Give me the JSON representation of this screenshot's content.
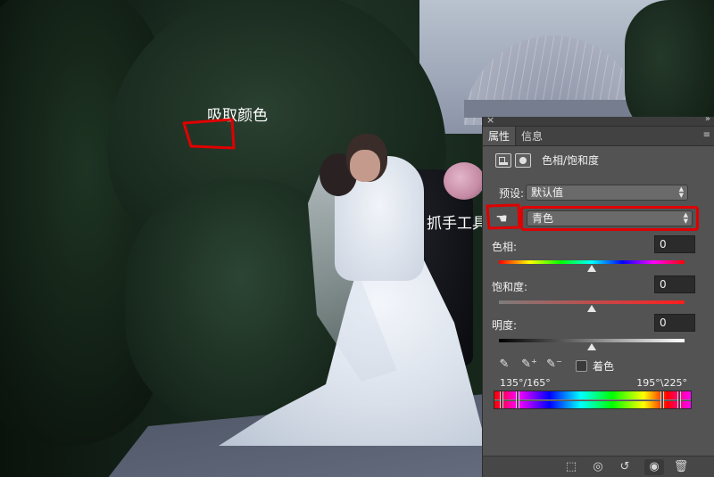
{
  "annotations": {
    "eyedropper_label": "吸取颜色",
    "hand_tool_label": "抓手工具"
  },
  "panel": {
    "tabs": [
      {
        "label": "属性",
        "active": true
      },
      {
        "label": "信息",
        "active": false
      }
    ],
    "adjustment_title": "色相/饱和度",
    "preset": {
      "label": "预设:",
      "value": "默认值"
    },
    "channel": {
      "value": "青色"
    },
    "hue": {
      "label": "色相:",
      "value": "0",
      "level": 0.5
    },
    "saturation": {
      "label": "饱和度:",
      "value": "0",
      "level": 0.5
    },
    "lightness": {
      "label": "明度:",
      "value": "0",
      "level": 0.5
    },
    "colorize": {
      "label": "着色",
      "checked": false
    },
    "range": {
      "left": "135°/165°",
      "right": "195°\\225°"
    },
    "icons": {
      "hand_tool": "hand-icon",
      "eyedropper": "eyedropper-icon",
      "eyedropper_add": "eyedropper-plus-icon",
      "eyedropper_subtract": "eyedropper-minus-icon",
      "footer": [
        "clip-to-layer-icon",
        "view-previous-icon",
        "reset-icon",
        "visibility-icon",
        "delete-icon"
      ]
    },
    "colors": {
      "highlight": "#e00000",
      "panel_bg": "#535353"
    }
  }
}
